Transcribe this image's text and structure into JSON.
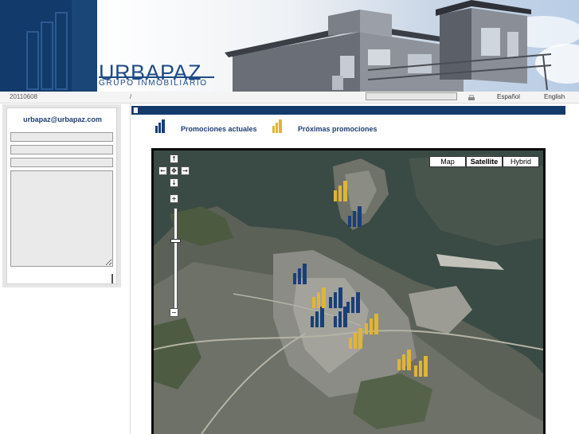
{
  "header": {
    "brand": "URBAPAZ",
    "subtitle": "GRUPO INMOBILIARIO",
    "logo_icon": "building-bars-icon"
  },
  "strip": {
    "date": "20110608",
    "breadcrumb": "/",
    "search_value": "",
    "lang_es": "Español",
    "lang_en": "English"
  },
  "sidebar": {
    "email": "urbapaz@urbapaz.com",
    "field1": "",
    "field2": "",
    "field3": "",
    "message": ""
  },
  "legend": {
    "current_label": "Promociones actuales",
    "upcoming_label": "Próximas promociones",
    "current_color": "#1a3f78",
    "upcoming_color": "#e0b534"
  },
  "map": {
    "types": [
      "Map",
      "Satellite",
      "Hybrid"
    ],
    "selected_type": "Satellite",
    "pan_up": "↑",
    "pan_down": "↓",
    "pan_left": "←",
    "pan_right": "→",
    "pan_center": "✥",
    "zoom_in": "+",
    "zoom_out": "−"
  }
}
